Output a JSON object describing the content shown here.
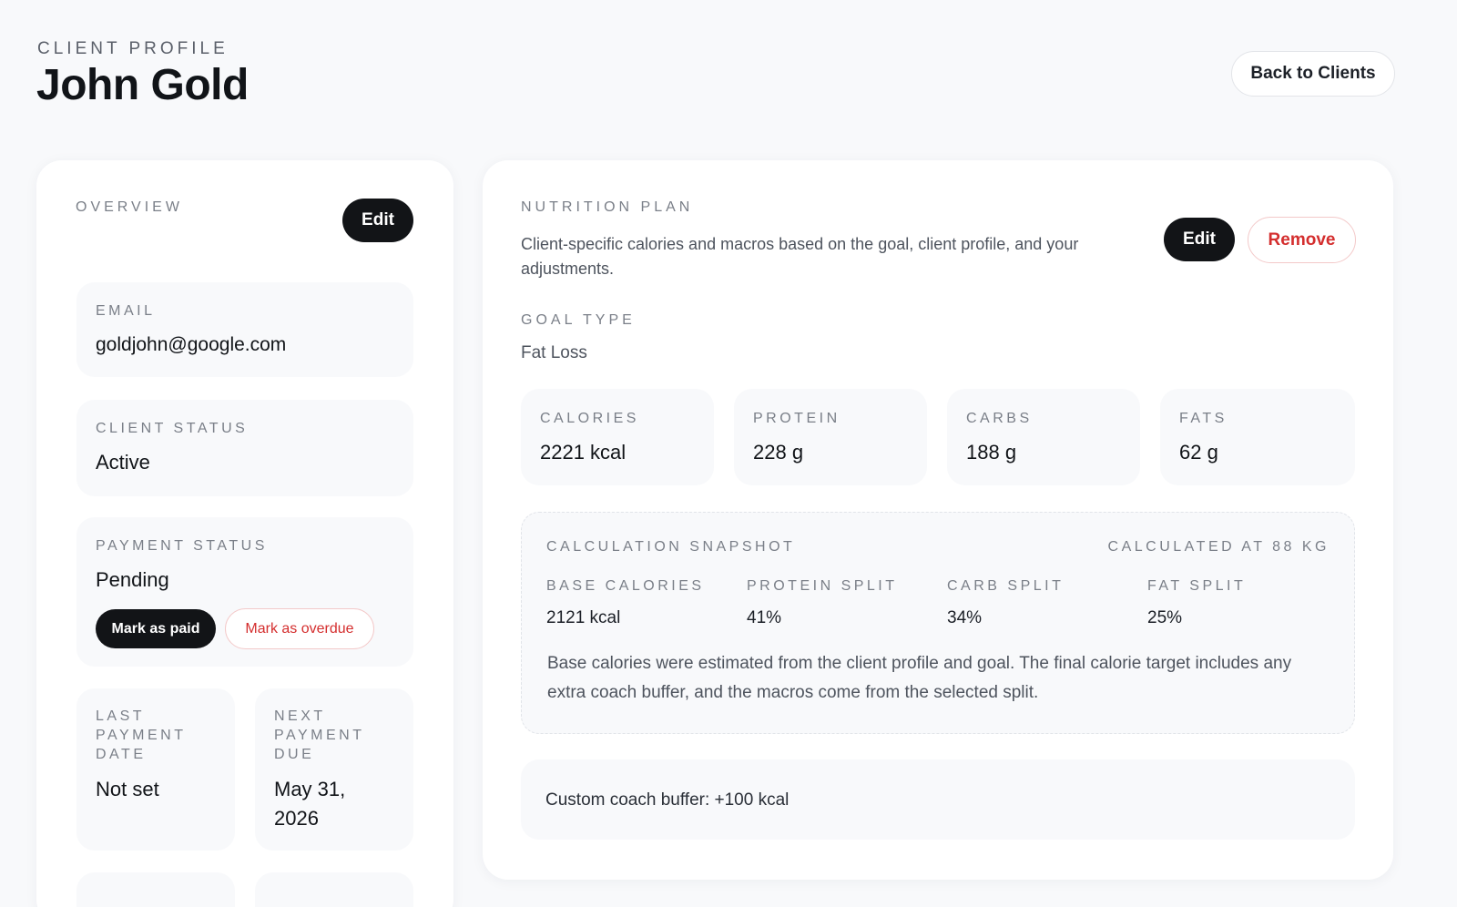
{
  "header": {
    "eyebrow": "CLIENT PROFILE",
    "client_name": "John Gold",
    "back_label": "Back to Clients"
  },
  "overview": {
    "title": "OVERVIEW",
    "edit_label": "Edit",
    "email": {
      "label": "EMAIL",
      "value": "goldjohn@google.com"
    },
    "client_status": {
      "label": "CLIENT STATUS",
      "value": "Active"
    },
    "payment_status": {
      "label": "PAYMENT STATUS",
      "value": "Pending",
      "mark_paid_label": "Mark as paid",
      "mark_overdue_label": "Mark as overdue"
    },
    "last_payment": {
      "label_lines": [
        "LAST",
        "PAYMENT",
        "DATE"
      ],
      "value": "Not set"
    },
    "next_payment": {
      "label_lines": [
        "NEXT",
        "PAYMENT",
        "DUE"
      ],
      "value_lines": [
        "May 31,",
        "2026"
      ]
    }
  },
  "nutrition": {
    "title": "NUTRITION PLAN",
    "description": "Client-specific calories and macros based on the goal, client profile, and your adjustments.",
    "edit_label": "Edit",
    "remove_label": "Remove",
    "goal_type": {
      "label": "GOAL TYPE",
      "value": "Fat Loss"
    },
    "macros": [
      {
        "label": "CALORIES",
        "value": "2221 kcal"
      },
      {
        "label": "PROTEIN",
        "value": "228 g"
      },
      {
        "label": "CARBS",
        "value": "188 g"
      },
      {
        "label": "FATS",
        "value": "62 g"
      }
    ],
    "snapshot": {
      "title": "CALCULATION SNAPSHOT",
      "calculated_at": "CALCULATED AT 88 KG",
      "items": [
        {
          "label": "BASE CALORIES",
          "value": "2121 kcal"
        },
        {
          "label": "PROTEIN SPLIT",
          "value": "41%"
        },
        {
          "label": "CARB SPLIT",
          "value": "34%"
        },
        {
          "label": "FAT SPLIT",
          "value": "25%"
        }
      ],
      "note": "Base calories were estimated from the client profile and goal. The final calorie target includes any extra coach buffer, and the macros come from the selected split."
    },
    "buffer_text": "Custom coach buffer: +100 kcal"
  },
  "colors": {
    "background": "#f8f9fb",
    "card": "#ffffff",
    "primary_dark": "#121417",
    "danger": "#d42e2e"
  }
}
